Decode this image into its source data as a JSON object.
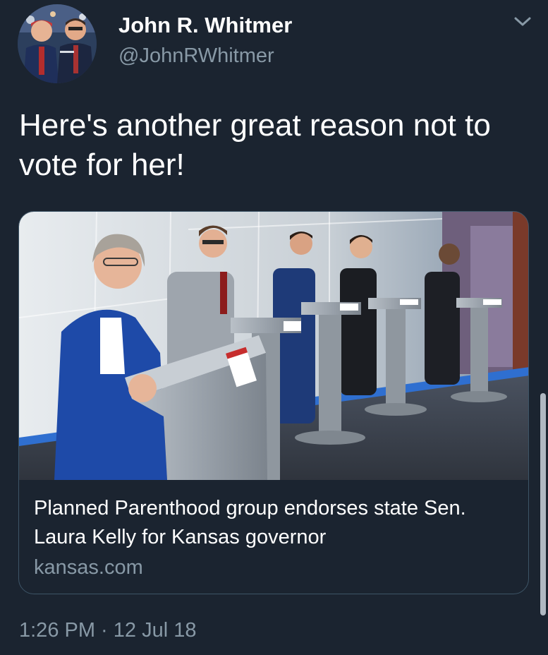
{
  "tweet": {
    "display_name": "John R. Whitmer",
    "handle": "@JohnRWhitmer",
    "text": "Here's another great reason not to vote for her!",
    "timestamp": "1:26 PM · 12 Jul 18"
  },
  "card": {
    "title": "Planned Parenthood group endorses state Sen. Laura Kelly for Kansas governor",
    "domain": "kansas.com"
  },
  "icons": {
    "menu": "chevron-down-icon"
  },
  "colors": {
    "background": "#1b2430",
    "secondary_text": "#8899a6",
    "card_border": "#3d5466"
  }
}
